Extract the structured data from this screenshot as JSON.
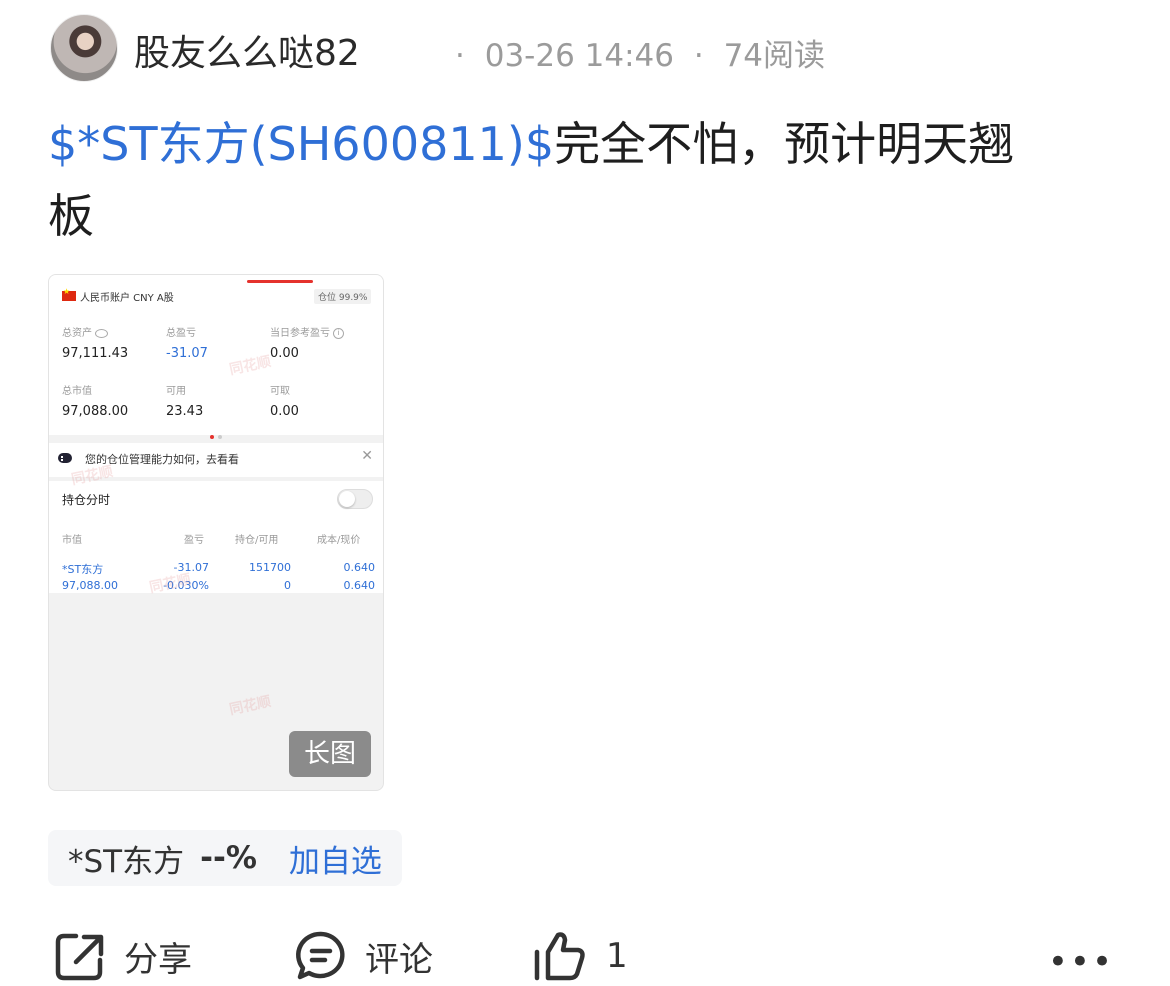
{
  "post": {
    "author": "股友么么哒82",
    "date": "03-26 14:46",
    "reads": "74阅读",
    "separator": "·",
    "stock_link": "$*ST东方(SH600811)$",
    "text_line1": "完全不怕，预计明天翘",
    "text_line2": "板"
  },
  "thumbnail": {
    "account_label": "人民币账户 CNY A股",
    "position_pct": "仓位 99.9%",
    "stats": [
      {
        "label": "总资产",
        "value": "97,111.43"
      },
      {
        "label": "总盈亏",
        "value": "-31.07"
      },
      {
        "label": "当日参考盈亏",
        "value": "0.00"
      },
      {
        "label": "总市值",
        "value": "97,088.00"
      },
      {
        "label": "可用",
        "value": "23.43"
      },
      {
        "label": "可取",
        "value": "0.00"
      }
    ],
    "banner_text": "您的仓位管理能力如何，去看看",
    "holdings_title": "持仓分时",
    "columns": [
      "市值",
      "盈亏",
      "持仓/可用",
      "成本/现价"
    ],
    "holding": {
      "name": "*ST东方",
      "market_value": "97,088.00",
      "profit": "-31.07",
      "profit_pct": "-0.030%",
      "position": "151700",
      "available": "0",
      "cost": "0.640",
      "price": "0.640"
    },
    "watermark": "同花顺",
    "long_image_label": "长图"
  },
  "stock_chip": {
    "name": "*ST东方",
    "change": "--%",
    "add_label": "加自选"
  },
  "actions": {
    "share_label": "分享",
    "comment_label": "评论",
    "like_count": "1",
    "more_label": "•••"
  },
  "colors": {
    "link_blue": "#2f6fd6",
    "meta_gray": "#9b9b9b",
    "accent_red": "#e5322d"
  }
}
